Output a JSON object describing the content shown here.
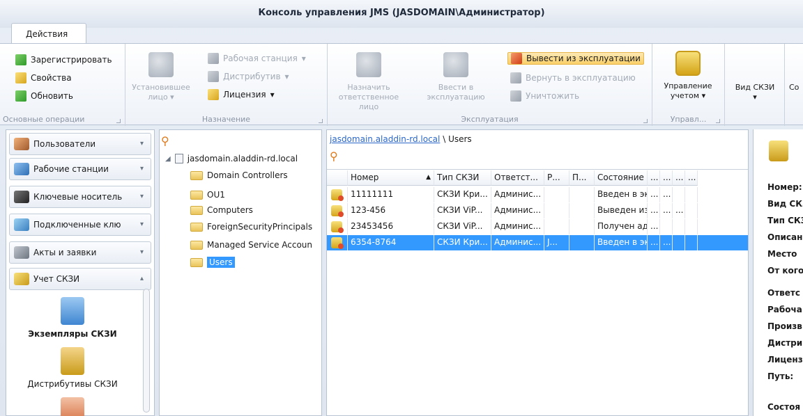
{
  "window": {
    "title": "Консоль управления JMS (JASDOMAIN\\Администратор)"
  },
  "ribbon": {
    "tab": "Действия",
    "groups": {
      "basic": {
        "label": "Основные операции",
        "register": "Зарегистрировать",
        "properties": "Свойства",
        "refresh": "Обновить"
      },
      "assignment": {
        "label": "Назначение",
        "installer": "Установившее лицо",
        "workstation": "Рабочая станция",
        "distributive": "Дистрибутив",
        "license": "Лицензия"
      },
      "exploitation": {
        "label": "Эксплуатация",
        "assign_responsible": "Назначить ответственное лицо",
        "commission": "Ввести в эксплуатацию",
        "decommission": "Вывести из эксплуатации",
        "return": "Вернуть в эксплуатацию",
        "destroy": "Уничтожить"
      },
      "accounting": {
        "label": "Управл...",
        "manage": "Управление учетом"
      },
      "view": {
        "label": "Вид СКЗИ"
      },
      "cut": {
        "label": "Со"
      }
    }
  },
  "nav": {
    "users": "Пользователи",
    "workstations": "Рабочие станции",
    "key_carriers": "Ключевые носитель",
    "connected": "Подключенные клю",
    "acts": "Акты и заявки",
    "accounting": "Учет СКЗИ",
    "instances": "Экземпляры СКЗИ",
    "distributives": "Дистрибутивы СКЗИ"
  },
  "tree": {
    "root": "jasdomain.aladdin-rd.local",
    "children": [
      "Domain Controllers",
      "OU1",
      "Computers",
      "ForeignSecurityPrincipals",
      "Managed Service Accoun",
      "Users"
    ]
  },
  "list": {
    "breadcrumb_link": "jasdomain.aladdin-rd.local",
    "breadcrumb_sep": "\\",
    "breadcrumb_current": "Users",
    "columns": [
      "Номер",
      "Тип СКЗИ",
      "Ответст...",
      "Р...",
      "П...",
      "Состояние",
      "...",
      "...",
      "...",
      "..."
    ],
    "rows": [
      [
        "11111111",
        "СКЗИ Кри...",
        "Админис...",
        "",
        "",
        "Введен в экс...",
        "...",
        "...",
        "",
        ""
      ],
      [
        "123-456",
        "СКЗИ ViP...",
        "Админис...",
        "",
        "",
        "Выведен из ...",
        "...",
        "...",
        "...",
        ""
      ],
      [
        "23453456",
        "СКЗИ ViP...",
        "Админис...",
        "",
        "",
        "Получен адм...",
        "...",
        "",
        "",
        ""
      ],
      [
        "6354-8764",
        "СКЗИ Кри...",
        "Админис...",
        "J...",
        "",
        "Введен в экс...",
        "...",
        "...",
        "",
        ""
      ]
    ],
    "selected_index": 3,
    "sort_indicator": "▲"
  },
  "detail": {
    "labels": [
      "Номер:",
      "Вид СКЗ",
      "Тип СКЗ",
      "Описан",
      "Место",
      "От кого",
      "Ответс",
      "Рабоча",
      "Произв",
      "Дистри",
      "Лиценз",
      "Путь:",
      "Состоя"
    ]
  }
}
